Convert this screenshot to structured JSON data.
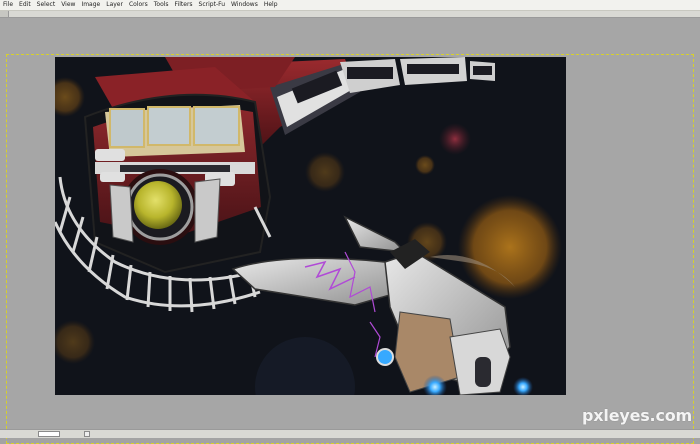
{
  "menubar": {
    "items": [
      {
        "label": "File"
      },
      {
        "label": "Edit"
      },
      {
        "label": "Select"
      },
      {
        "label": "View"
      },
      {
        "label": "Image"
      },
      {
        "label": "Layer"
      },
      {
        "label": "Colors"
      },
      {
        "label": "Tools"
      },
      {
        "label": "Filters"
      },
      {
        "label": "Script-Fu"
      },
      {
        "label": "Windows"
      },
      {
        "label": "Help"
      }
    ]
  },
  "canvas": {
    "artwork": "space-station-and-spaceship-illustration",
    "colors": {
      "space": "#0b0d12",
      "station_red": "#7a1d22",
      "hull_gray": "#c9c9c9",
      "porthole_yellow": "#c7c43a",
      "bokeh_orange": "#c9821a",
      "engine_blue": "#33a8ff"
    }
  },
  "watermark": {
    "text": "pxleyes.com"
  }
}
